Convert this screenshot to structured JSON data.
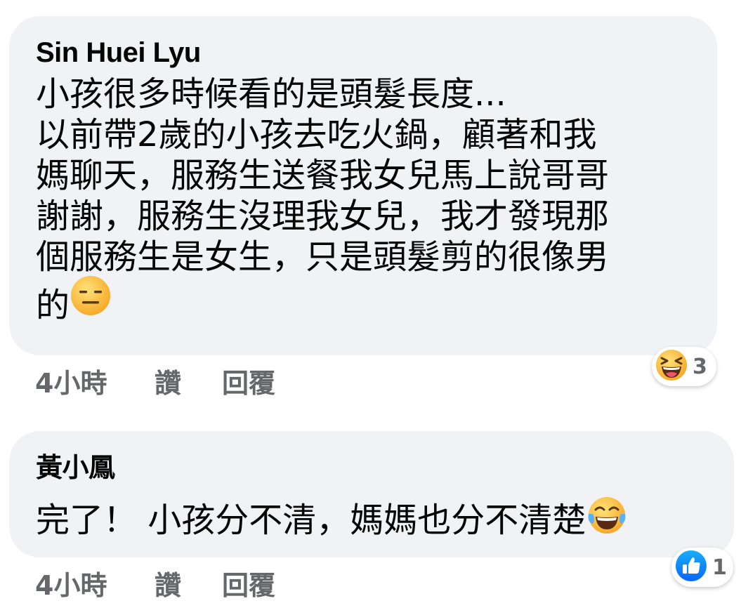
{
  "comments": [
    {
      "author": "Sin Huei Lyu",
      "lines": [
        "小孩很多時候看的是頭髮長度...",
        "以前帶2歲的小孩去吃火鍋，顧著和我",
        "媽聊天，服務生送餐我女兒馬上說哥哥",
        "謝謝，服務生沒理我女兒，我才發現那",
        "個服務生是女生，只是頭髮剪的很像男"
      ],
      "last_line": "的",
      "trailing_emoji": "expressionless-face-icon",
      "time": "4小時",
      "like_label": "讚",
      "reply_label": "回覆",
      "reaction_icon": "laughing-face-icon",
      "reaction_count": "3"
    },
    {
      "author": "黃小鳳",
      "text": "完了！ 小孩分不清，媽媽也分不清楚",
      "trailing_emoji": "tears-of-joy-icon",
      "time": "4小時",
      "like_label": "讚",
      "reply_label": "回覆",
      "reaction_icon": "like-thumb-icon",
      "reaction_count": "1"
    }
  ],
  "colors": {
    "bubble_bg": "#f0f2f5",
    "text": "#050505",
    "meta": "#65676b",
    "like_blue": "#1877f2",
    "emoji_yellow": "#ffcb4c"
  }
}
